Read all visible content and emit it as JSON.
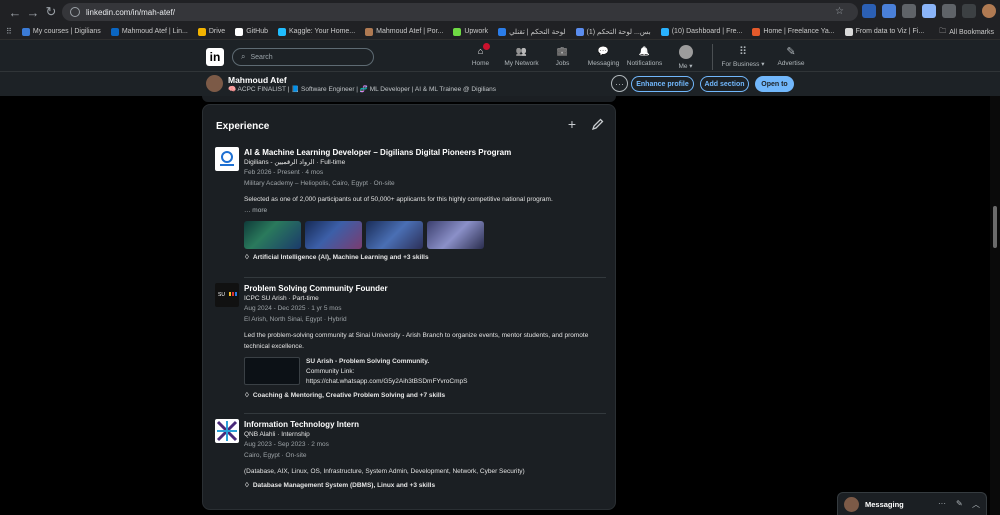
{
  "browser": {
    "url": "linkedin.com/in/mah-atef/",
    "bookmarks": [
      {
        "label": "My courses | Digilians",
        "color": "#3b7bd6"
      },
      {
        "label": "Mahmoud Atef | Lin...",
        "color": "#0a66c2"
      },
      {
        "label": "Drive",
        "color": "#f4b400"
      },
      {
        "label": "GitHub",
        "color": "#ffffff"
      },
      {
        "label": "Kaggle: Your Home...",
        "color": "#20beff"
      },
      {
        "label": "Mahmoud Atef | Por...",
        "color": "#b07a52"
      },
      {
        "label": "Upwork",
        "color": "#6fda44"
      },
      {
        "label": "لوحة التحكم | تقنلي",
        "color": "#2b7de9"
      },
      {
        "label": "بس... لوحة التحكم (1)",
        "color": "#5b8def"
      },
      {
        "label": "(10) Dashboard | Fre...",
        "color": "#29b2fe"
      },
      {
        "label": "Home | Freelance Ya...",
        "color": "#e55a2b"
      },
      {
        "label": "From data to Viz | Fi...",
        "color": "#d9d9d9"
      }
    ],
    "all_bookmarks": "All Bookmarks"
  },
  "header": {
    "search_placeholder": "Search",
    "nav": [
      {
        "label": "Home",
        "icon": "home-icon",
        "badge": true
      },
      {
        "label": "My Network",
        "icon": "network-icon",
        "badge": false
      },
      {
        "label": "Jobs",
        "icon": "briefcase-icon",
        "badge": false
      },
      {
        "label": "Messaging",
        "icon": "chat-icon",
        "badge": false
      },
      {
        "label": "Notifications",
        "icon": "bell-icon",
        "badge": false
      },
      {
        "label": "Me ▾",
        "icon": "avatar",
        "badge": false
      }
    ],
    "for_business": "For Business ▾",
    "advertise": "Advertise"
  },
  "profile_bar": {
    "name": "Mahmoud Atef",
    "headline": "🧠 ACPC FINALIST  |  📘 Software Engineer  |  🧬 ML Developer | AI & ML Trainee @ Digilians",
    "enhance_label": "Enhance profile",
    "add_section_label": "Add section",
    "open_to_label": "Open to",
    "more_label": "···"
  },
  "experience": {
    "title": "Experience",
    "items": [
      {
        "title": "AI & Machine Learning Developer – Digilians Digital Pioneers Program",
        "company": "Digilians - الرواد الرقميين · Full-time",
        "dates": "Feb 2026 - Present · 4 mos",
        "location": "Military Academy – Heliopolis, Cairo, Egypt · On-site",
        "description": "Selected as one of 2,000 participants out of 50,000+ applicants for this highly competitive national program.",
        "more": "… more",
        "skills": "Artificial Intelligence (AI), Machine Learning and +3 skills"
      },
      {
        "title": "Problem Solving Community Founder",
        "company": "ICPC SU Arish · Part-time",
        "dates": "Aug 2024 - Dec 2025 · 1 yr 5 mos",
        "location": "El Arish, North Sinai, Egypt · Hybrid",
        "description": "Led the problem-solving community at Sinai University - Arish Branch to organize events, mentor students, and promote technical excellence.",
        "media_title": "SU Arish - Problem Solving Community.",
        "media_line2": "Community Link:",
        "media_line3": "https://chat.whatsapp.com/G5y2Aih3tBSDmFYvroCmpS",
        "skills": "Coaching & Mentoring, Creative Problem Solving and +7 skills"
      },
      {
        "title": "Information Technology Intern",
        "company": "QNB Alahli · Internship",
        "dates": "Aug 2023 - Sep 2023 · 2 mos",
        "location": "Cairo, Egypt · On-site",
        "description": "(Database, AIX, Linux, OS, Infrastructure, System Admin, Development, Network, Cyber Security)",
        "skills": "Database Management System (DBMS), Linux and +3 skills"
      }
    ]
  },
  "messaging": {
    "label": "Messaging"
  }
}
